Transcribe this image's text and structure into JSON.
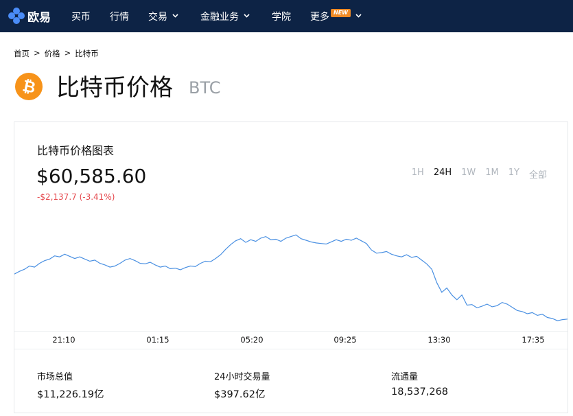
{
  "nav": {
    "logo_text": "欧易",
    "items": [
      {
        "label": "买币",
        "dropdown": false
      },
      {
        "label": "行情",
        "dropdown": false
      },
      {
        "label": "交易",
        "dropdown": true
      },
      {
        "label": "金融业务",
        "dropdown": true
      },
      {
        "label": "学院",
        "dropdown": false
      },
      {
        "label": "更多",
        "dropdown": true,
        "badge": "NEW"
      }
    ]
  },
  "breadcrumb": [
    "首页",
    "价格",
    "比特币"
  ],
  "breadcrumb_sep": ">",
  "coin": {
    "name": "比特币价格",
    "symbol": "BTC",
    "icon": "bitcoin-icon",
    "icon_glyph": "₿",
    "icon_color": "#f7931a"
  },
  "chart_card": {
    "title": "比特币价格图表",
    "price": "$60,585.60",
    "change": "-$2,137.7 (-3.41%)",
    "ranges": [
      "1H",
      "24H",
      "1W",
      "1M",
      "1Y",
      "全部"
    ],
    "active_range": "24H"
  },
  "chart_data": {
    "type": "line",
    "series": [
      {
        "line_color": "#4a90e2",
        "values": [
          62860,
          62910,
          62950,
          63010,
          62990,
          63060,
          63110,
          63140,
          63200,
          63180,
          63230,
          63190,
          63150,
          63180,
          63140,
          63100,
          63120,
          63060,
          63030,
          62990,
          63010,
          63060,
          63120,
          63150,
          63110,
          63060,
          63050,
          63080,
          63030,
          62990,
          63010,
          62960,
          62970,
          62940,
          62980,
          63010,
          63000,
          63060,
          63100,
          63090,
          63150,
          63220,
          63320,
          63410,
          63480,
          63520,
          63450,
          63500,
          63470,
          63530,
          63560,
          63500,
          63510,
          63470,
          63530,
          63560,
          63590,
          63520,
          63490,
          63460,
          63440,
          63430,
          63420,
          63460,
          63500,
          63470,
          63510,
          63490,
          63530,
          63480,
          63430,
          63310,
          63250,
          63260,
          63280,
          63230,
          63200,
          63180,
          63220,
          63170,
          63190,
          63120,
          63050,
          62950,
          62700,
          62520,
          62600,
          62470,
          62380,
          62470,
          62280,
          62290,
          62230,
          62260,
          62300,
          62250,
          62270,
          62330,
          62300,
          62240,
          62180,
          62160,
          62120,
          62140,
          62090,
          62110,
          62050,
          62030,
          61990,
          62010,
          62020
        ]
      }
    ],
    "x_labels": [
      "21:10",
      "01:15",
      "05:20",
      "09:25",
      "13:30",
      "17:35"
    ],
    "y_range": [
      61800,
      63900
    ],
    "grid": false
  },
  "stats": [
    {
      "label": "市场总值",
      "value": "$11,226.19亿"
    },
    {
      "label": "24小时交易量",
      "value": "$397.62亿"
    },
    {
      "label": "流通量",
      "value": "18,537,268"
    }
  ],
  "colors": {
    "nav_bg": "#0d2345",
    "accent": "#4a90e2",
    "negative": "#e5484d",
    "badge": "#f08a24"
  }
}
